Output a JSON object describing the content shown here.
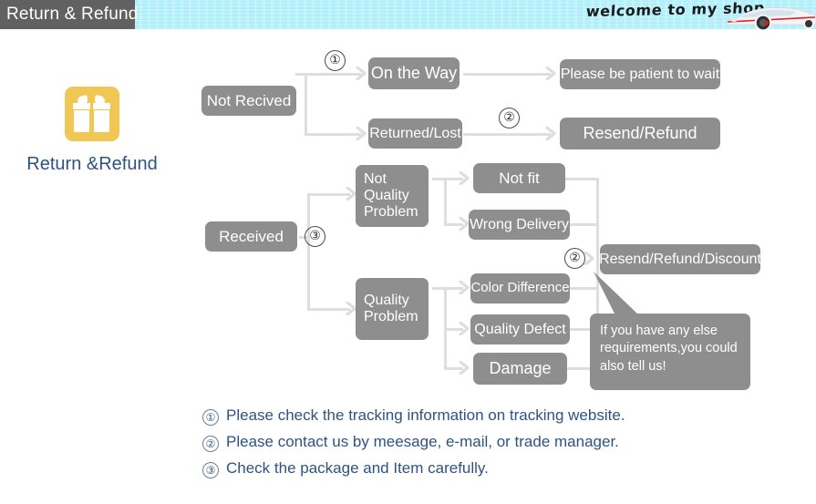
{
  "header": {
    "tab_label": "Return & Refund",
    "welcome_text": "welcome to my shop",
    "car_icon": "sports-car-icon",
    "stripe_color": "#b7f1fb",
    "tab_color": "#616161"
  },
  "brand": {
    "icon": "gift-box-icon",
    "icon_color": "#f0c752",
    "label": "Return &Refund",
    "label_color": "#2d5382"
  },
  "flow": {
    "node_color": "#8e8e8e",
    "line_color": "#dedede",
    "nodes": [
      {
        "id": "not-recived",
        "label": "Not Recived"
      },
      {
        "id": "on-the-way",
        "label": "On the Way"
      },
      {
        "id": "returned-lost",
        "label": "Returned/Lost"
      },
      {
        "id": "please-be-patient",
        "label": "Please be patient to wait"
      },
      {
        "id": "resend-refund",
        "label": "Resend/Refund"
      },
      {
        "id": "received",
        "label": "Received"
      },
      {
        "id": "not-quality-problem",
        "label": "Not\nQuality\nProblem"
      },
      {
        "id": "quality-problem",
        "label": "Quality\nProblem"
      },
      {
        "id": "not-fit",
        "label": "Not fit"
      },
      {
        "id": "wrong-delivery",
        "label": "Wrong Delivery"
      },
      {
        "id": "color-difference",
        "label": "Color Difference"
      },
      {
        "id": "quality-defect",
        "label": "Quality Defect"
      },
      {
        "id": "damage",
        "label": "Damage"
      },
      {
        "id": "resend-refund-discount",
        "label": "Resend/Refund/Discount"
      }
    ],
    "markers": [
      {
        "id": "marker-1-top",
        "label": "①"
      },
      {
        "id": "marker-2-top",
        "label": "②"
      },
      {
        "id": "marker-3-received",
        "label": "③"
      },
      {
        "id": "marker-2-bottom",
        "label": "②"
      }
    ]
  },
  "bubble": {
    "text": "If you have any else requirements,you could also tell us!"
  },
  "notes": [
    {
      "num": "①",
      "text": "Please check the tracking information on tracking website."
    },
    {
      "num": "②",
      "text": "Please contact us by meesage, e-mail, or trade manager."
    },
    {
      "num": "③",
      "text": "Check the package and Item carefully."
    }
  ]
}
